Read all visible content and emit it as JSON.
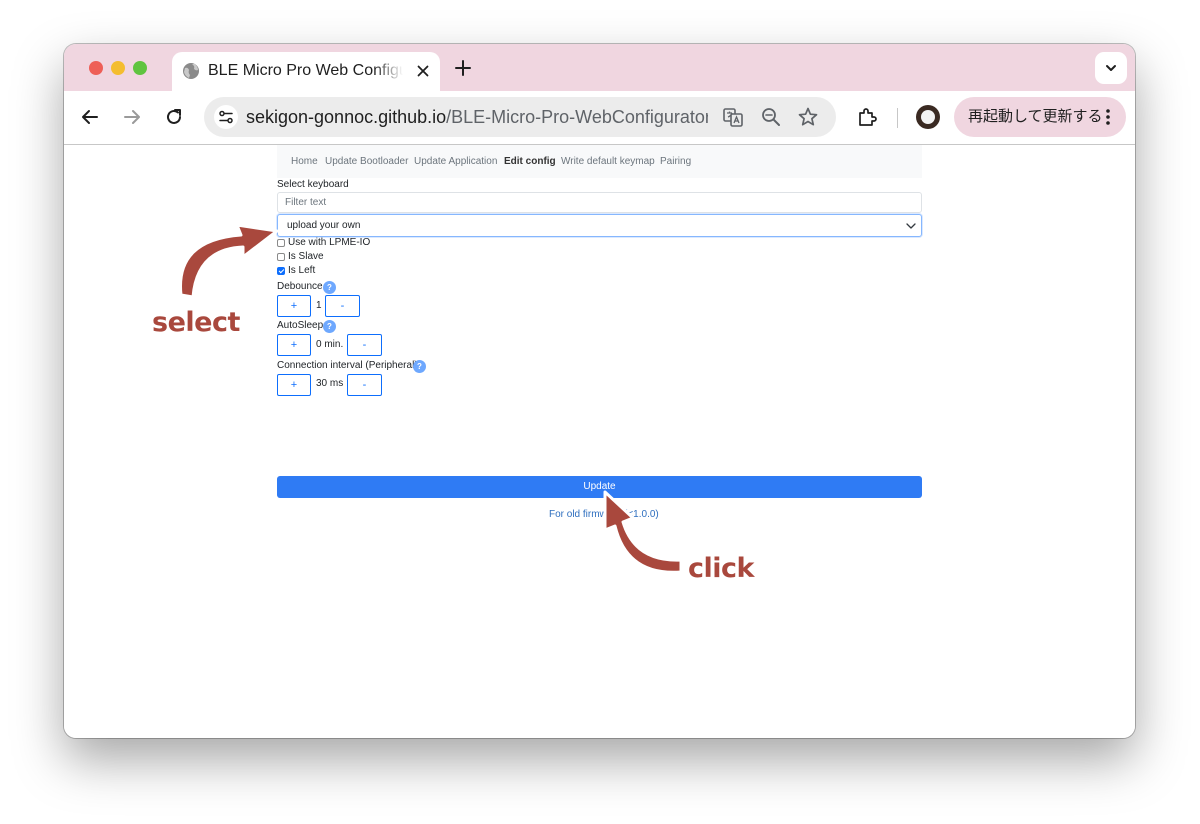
{
  "browser": {
    "tab_title": "BLE Micro Pro Web Configurator",
    "url_host": "sekigon-gonnoc.github.io",
    "url_path": "/BLE-Micro-Pro-WebConfigurator/",
    "relaunch_label": "再起動して更新する"
  },
  "nav": {
    "items": [
      "Home",
      "Update Bootloader",
      "Update Application",
      "Edit config",
      "Write default keymap",
      "Pairing"
    ],
    "active": "Edit config"
  },
  "form": {
    "select_keyboard_label": "Select keyboard",
    "filter_placeholder": "Filter text",
    "keyboard_selected": "upload your own",
    "checkboxes": [
      {
        "label": "Use with LPME-IO",
        "checked": false
      },
      {
        "label": "Is Slave",
        "checked": false
      },
      {
        "label": "Is Left",
        "checked": true
      }
    ],
    "help_glyph": "?",
    "plus": "+",
    "minus": "-",
    "debounce": {
      "label": "Debounce",
      "value": "1"
    },
    "autosleep": {
      "label": "AutoSleep",
      "value": "0 min."
    },
    "conn_interval": {
      "label": "Connection interval (Peripheral)",
      "value": "30 ms"
    },
    "update_button": "Update",
    "old_firmware_link": "For old firmware (<1.0.0)"
  },
  "annotations": {
    "select": "select",
    "click": "click",
    "color": "#a9483d"
  },
  "colors": {
    "tabbar": "#f0d6e0",
    "primary": "#2f7bf4",
    "help": "#6ea8fe"
  },
  "icons": [
    "globe-icon",
    "close-icon",
    "plus-icon",
    "chevron-down-icon",
    "back-arrow-icon",
    "forward-arrow-icon",
    "reload-icon",
    "tune-icon",
    "translate-icon",
    "zoom-icon",
    "star-icon",
    "extensions-icon",
    "more-vert-icon"
  ]
}
